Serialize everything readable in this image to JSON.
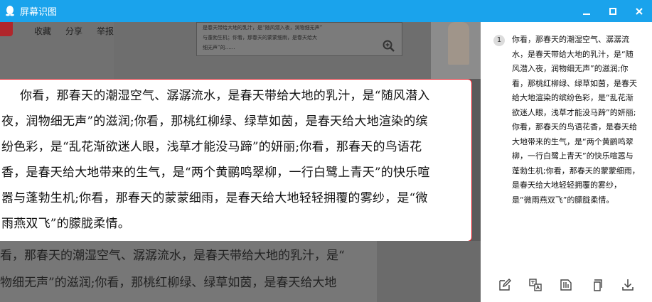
{
  "window": {
    "title": "屏幕识图"
  },
  "capture": {
    "toolbar_items": [
      "收藏",
      "分享",
      "举报"
    ],
    "page_snippet_lines": [
      "是春天带给大地的乳汁，是“随风潜入夜，润物细无声”",
      "与蓬勃生机；你看，那春天的蒙蒙细雨，是春天给大",
      "细无声”的……"
    ],
    "selected_lines": [
      "你看，那春天的潮湿空气、潺潺流水，是春天带给大地的乳汁，是“随风潜入",
      "夜，润物细无声”的滋润;你看，那桃红柳绿、绿草如茵，是春天给大地渲染的缤",
      "纷色彩，是“乱花渐欲迷人眼，浅草才能没马蹄”的妍丽;你看，那春天的鸟语花",
      "香，是春天给大地带来的生气，是“两个黄鹂鸣翠柳，一行白鹭上青天”的快乐喧",
      "嚣与蓬勃生机;你看，那春天的蒙蒙细雨，是春天给大地轻轻拥覆的雾纱，是“微",
      "雨燕双飞”的朦胧柔情。"
    ],
    "bottom_lines": [
      "看，那春天的潮湿空气、潺潺流水，是春天带给大地的乳汁，是“",
      "物细无声”的滋润;你看，那桃红柳绿、绿草如茵，是春天给大地"
    ]
  },
  "result": {
    "index": "1",
    "text": "你看，那春天的潮湿空气、潺潺流水，是春天带给大地的乳汁，是“随风潜入夜，润物细无声”的滋润;你看，那桃红柳绿、绿草如茵，是春天给大地渲染的缤纷色彩，是“乱花渐欲迷人眼，浅草才能没马蹄”的妍丽;你看，那春天的鸟语花香，是春天给大地带来的生气，是“两个黄鹂鸣翠柳，一行白鹭上青天”的快乐喧嚣与蓬勃生机;你看，那春天的蒙蒙细雨，是春天给大地轻轻拥覆的雾纱，是“微雨燕双飞”的朦胧柔情。",
    "actions": [
      "edit-icon",
      "translate-icon",
      "screenshot-icon",
      "copy-icon",
      "download-icon"
    ]
  },
  "colors": {
    "titlebar": "#1aa3ec",
    "selection_border": "#e0202a"
  }
}
